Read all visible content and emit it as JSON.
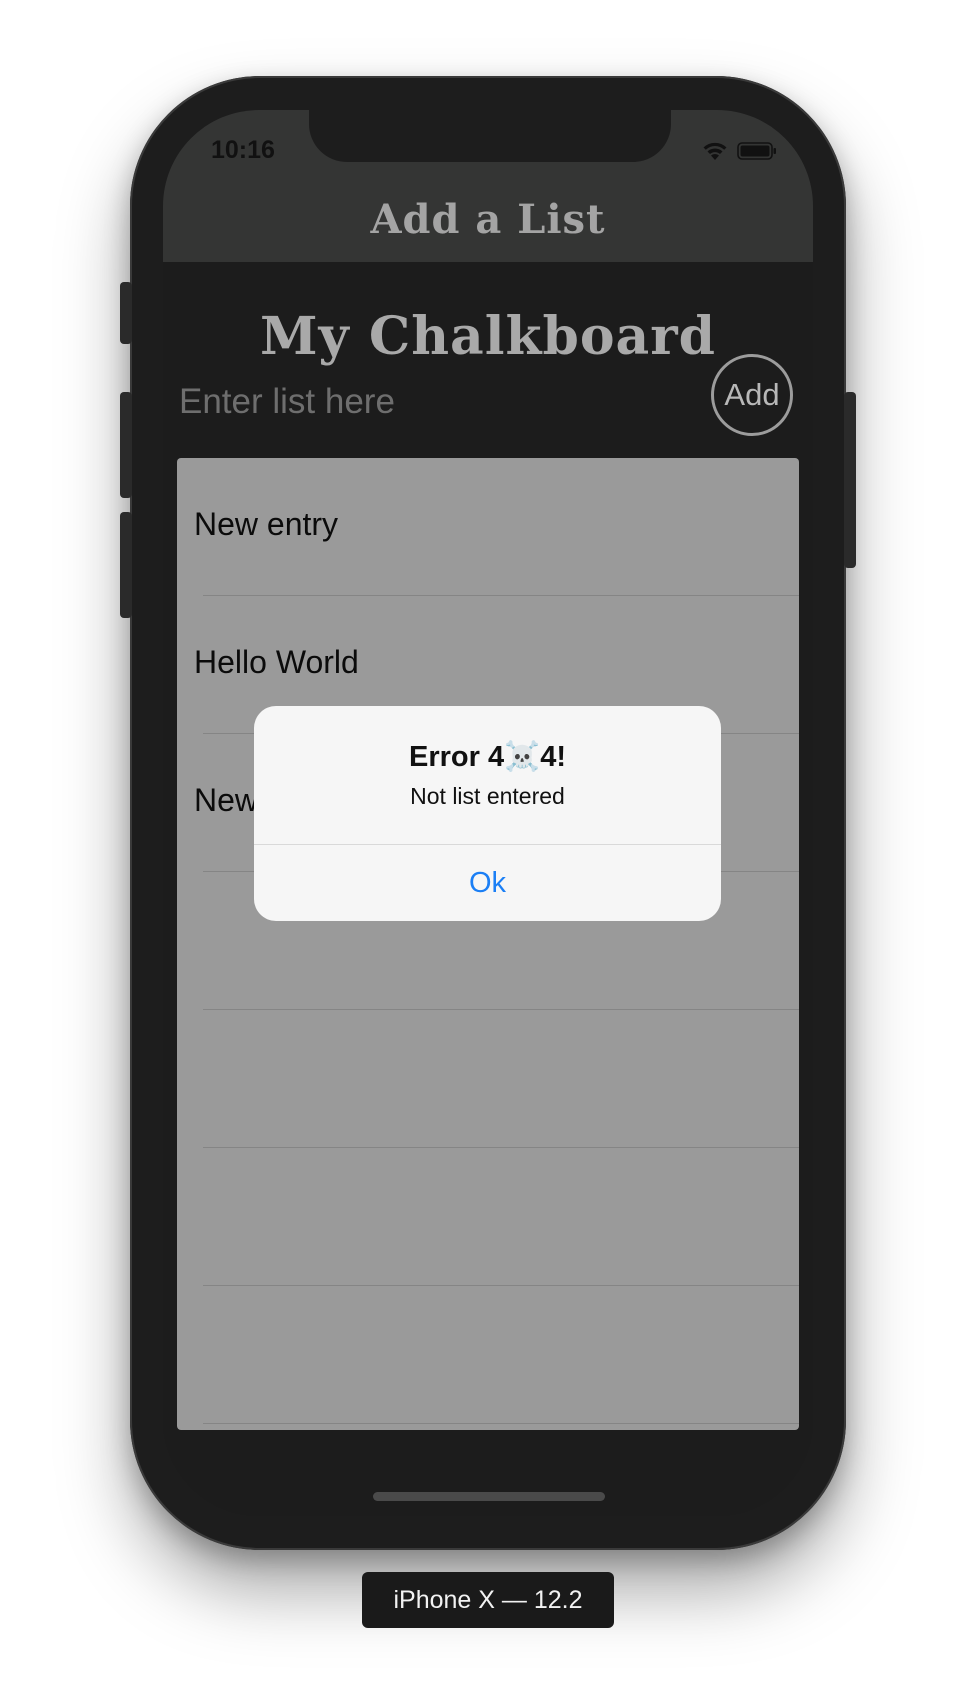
{
  "status_bar": {
    "time": "10:16",
    "icons": [
      "wifi-icon",
      "battery-icon"
    ]
  },
  "nav": {
    "title": "Add a List"
  },
  "main": {
    "title": "My Chalkboard",
    "input_placeholder": "Enter list here",
    "input_value": "",
    "add_button_label": "Add"
  },
  "list": {
    "items": [
      {
        "label": "New entry"
      },
      {
        "label": "Hello World"
      },
      {
        "label": "New entry"
      },
      {
        "label": ""
      },
      {
        "label": ""
      },
      {
        "label": ""
      },
      {
        "label": ""
      }
    ]
  },
  "alert": {
    "title": "Error 4☠️4!",
    "message": "Not list entered",
    "button_label": "Ok"
  },
  "device": {
    "label": "iPhone X — 12.2"
  },
  "colors": {
    "screen_background": "#1c1c1c",
    "navbar_background": "#343534",
    "list_background": "#9a9a9a",
    "alert_background": "#f6f6f6",
    "alert_button": "#1b7ff5",
    "title_text": "#a9a9a9"
  }
}
